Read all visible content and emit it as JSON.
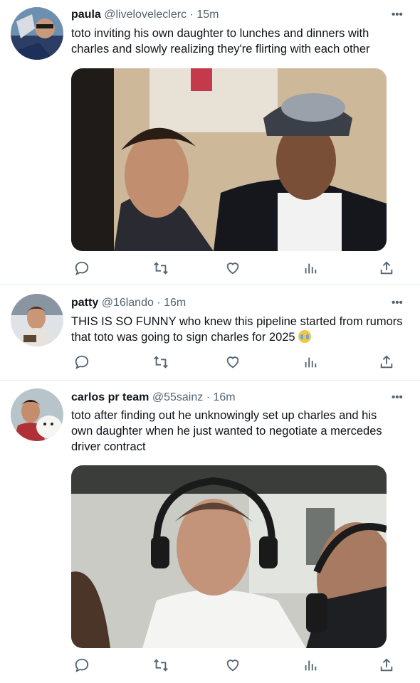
{
  "tweets": [
    {
      "name": "paula",
      "handle": "@liveloveleclerc",
      "time": "· 15m",
      "text": "toto inviting his own daughter to lunches and dinners with charles and slowly realizing they're flirting with each other",
      "has_media": true,
      "media_description_icon": "photo-icon"
    },
    {
      "name": "patty",
      "handle": "@16lando",
      "time": "· 16m",
      "text": "THIS IS SO FUNNY who knew this pipeline started from rumors that toto was going to sign charles for 2025",
      "emoji_icon": "loudly-crying-face-icon",
      "has_media": false
    },
    {
      "name": "carlos pr team",
      "handle": "@55sainz",
      "time": "· 16m",
      "text": "toto after finding out he unknowingly set up charles and his own daughter when he just wanted to negotiate a mercedes driver contract",
      "has_media": true,
      "media_description_icon": "photo-icon"
    }
  ],
  "more_label": "•••",
  "action_icons": [
    "reply-icon",
    "retweet-icon",
    "like-icon",
    "views-icon",
    "share-icon"
  ],
  "colors": {
    "text": "#0f1419",
    "secondary": "#536471",
    "separator": "#e6ecf0"
  }
}
